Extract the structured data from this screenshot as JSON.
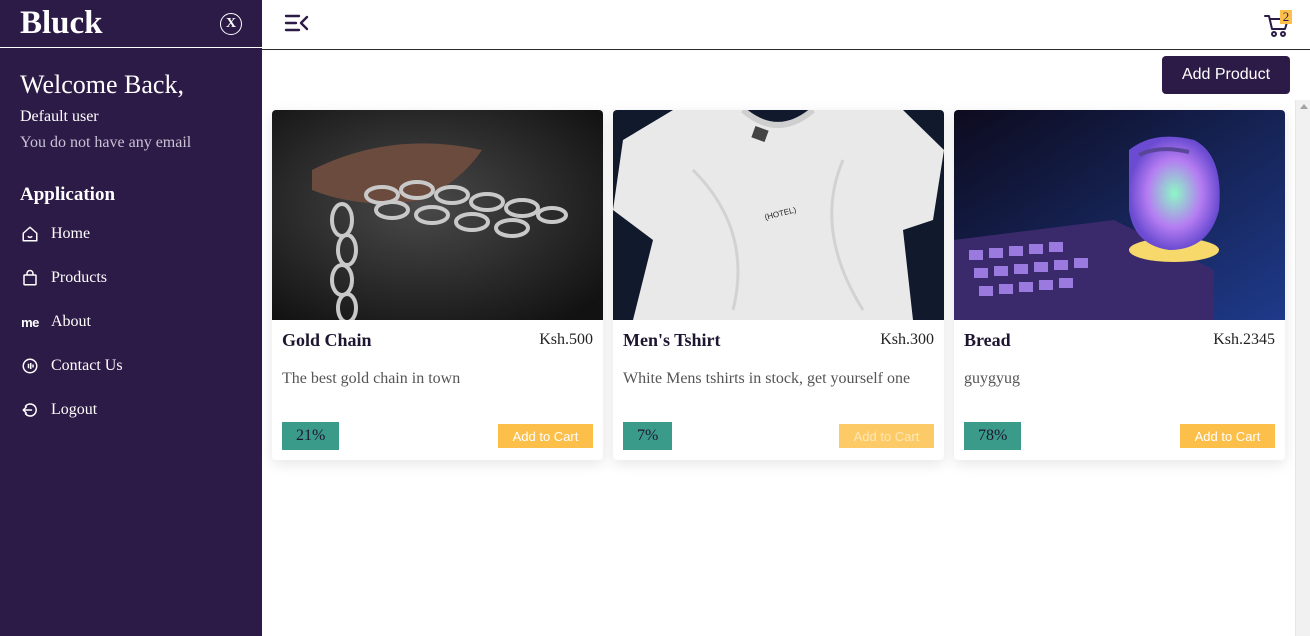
{
  "brand": "Bluck",
  "close_label": "X",
  "welcome": "Welcome Back,",
  "user": {
    "name": "Default user",
    "email": "You do not have any email"
  },
  "nav_section": "Application",
  "nav": [
    {
      "label": "Home",
      "icon": "home-icon"
    },
    {
      "label": "Products",
      "icon": "shopping-bag-icon"
    },
    {
      "label": "About",
      "icon": "me-icon",
      "icon_text": "me"
    },
    {
      "label": "Contact Us",
      "icon": "contact-icon"
    },
    {
      "label": "Logout",
      "icon": "logout-icon"
    }
  ],
  "cart": {
    "count": "2",
    "icon": "cart-icon"
  },
  "add_product_label": "Add Product",
  "products": [
    {
      "title": "Gold Chain",
      "price": "Ksh.500",
      "description": "The best gold chain in town",
      "discount": "21%",
      "button": "Add to Cart",
      "image": "chain-hand-photo"
    },
    {
      "title": "Men's Tshirt",
      "price": "Ksh.300",
      "description": "White Mens tshirts in stock, get yourself one",
      "discount": "7%",
      "button": "Add to Cart",
      "image": "white-tshirt-photo",
      "image_text": "(HOTEL)"
    },
    {
      "title": "Bread",
      "price": "Ksh.2345",
      "description": "guygyug",
      "discount": "78%",
      "button": "Add to Cart",
      "image": "gaming-mouse-photo"
    }
  ],
  "colors": {
    "sidebar": "#2d1b47",
    "accent": "#fbbf4a",
    "discount": "#3b9b8b"
  }
}
